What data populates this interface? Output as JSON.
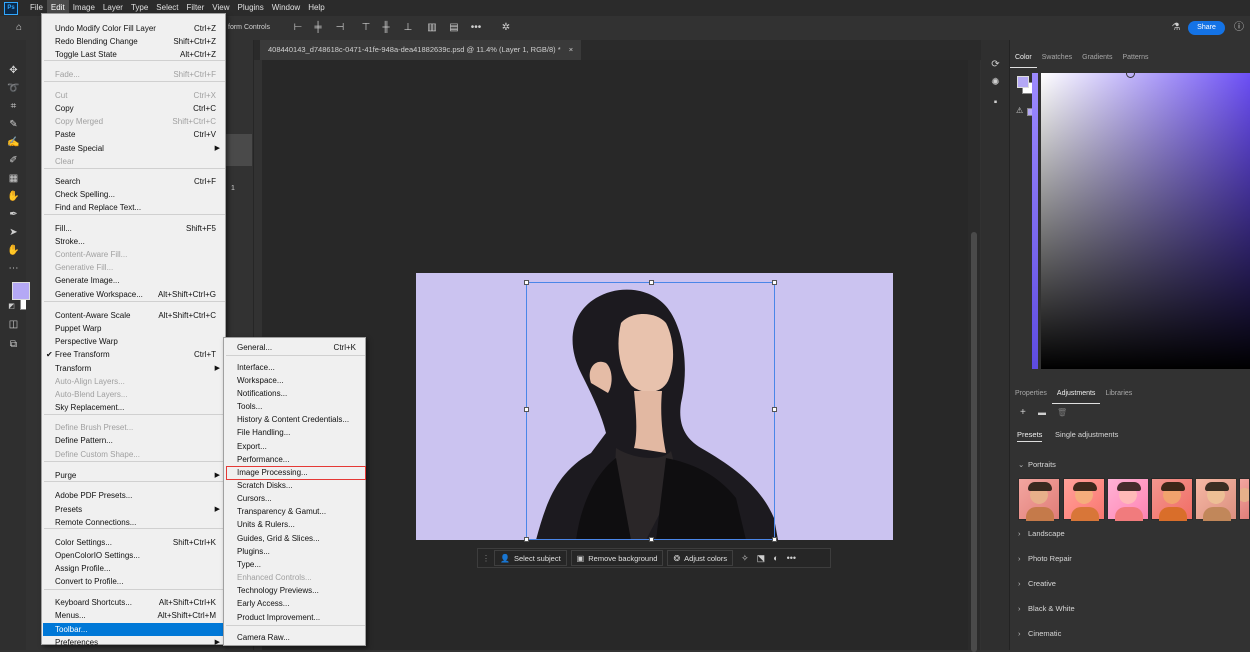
{
  "menubar": {
    "app_logo": "Ps",
    "items": [
      "File",
      "Edit",
      "Image",
      "Layer",
      "Type",
      "Select",
      "Filter",
      "View",
      "Plugins",
      "Window",
      "Help"
    ]
  },
  "options_bar": {
    "transform_controls_label": "form Controls",
    "share_label": "Share",
    "icons": [
      "home-icon",
      "align-icons",
      "more-icon",
      "gear-icon",
      "flask-icon"
    ]
  },
  "document": {
    "tab_title": "408440143_d748618c-0471-41fe-948a-dea41882639c.psd @ 11.4% (Layer 1, RGB/8) *",
    "tab_close": "×"
  },
  "left_panel": {
    "fragment": "1"
  },
  "edit_menu": {
    "items": [
      {
        "label": "Undo Modify Color Fill Layer",
        "shortcut": "Ctrl+Z"
      },
      {
        "label": "Redo Blending Change",
        "shortcut": "Shift+Ctrl+Z"
      },
      {
        "label": "Toggle Last State",
        "shortcut": "Alt+Ctrl+Z"
      },
      {
        "label": "Fade...",
        "shortcut": "Shift+Ctrl+F",
        "disabled": true
      },
      {
        "label": "Cut",
        "shortcut": "Ctrl+X",
        "disabled": true
      },
      {
        "label": "Copy",
        "shortcut": "Ctrl+C"
      },
      {
        "label": "Copy Merged",
        "shortcut": "Shift+Ctrl+C",
        "disabled": true
      },
      {
        "label": "Paste",
        "shortcut": "Ctrl+V"
      },
      {
        "label": "Paste Special",
        "submenu": true
      },
      {
        "label": "Clear",
        "disabled": true
      },
      {
        "label": "Search",
        "shortcut": "Ctrl+F"
      },
      {
        "label": "Check Spelling..."
      },
      {
        "label": "Find and Replace Text..."
      },
      {
        "label": "Fill...",
        "shortcut": "Shift+F5"
      },
      {
        "label": "Stroke..."
      },
      {
        "label": "Content-Aware Fill...",
        "disabled": true
      },
      {
        "label": "Generative Fill...",
        "disabled": true
      },
      {
        "label": "Generate Image..."
      },
      {
        "label": "Generative Workspace...",
        "shortcut": "Alt+Shift+Ctrl+G"
      },
      {
        "label": "Content-Aware Scale",
        "shortcut": "Alt+Shift+Ctrl+C"
      },
      {
        "label": "Puppet Warp"
      },
      {
        "label": "Perspective Warp"
      },
      {
        "label": "Free Transform",
        "shortcut": "Ctrl+T",
        "checked": true
      },
      {
        "label": "Transform",
        "submenu": true
      },
      {
        "label": "Auto-Align Layers...",
        "disabled": true
      },
      {
        "label": "Auto-Blend Layers...",
        "disabled": true
      },
      {
        "label": "Sky Replacement..."
      },
      {
        "label": "Define Brush Preset...",
        "disabled": true
      },
      {
        "label": "Define Pattern..."
      },
      {
        "label": "Define Custom Shape...",
        "disabled": true
      },
      {
        "label": "Purge",
        "submenu": true
      },
      {
        "label": "Adobe PDF Presets..."
      },
      {
        "label": "Presets",
        "submenu": true
      },
      {
        "label": "Remote Connections..."
      },
      {
        "label": "Color Settings...",
        "shortcut": "Shift+Ctrl+K"
      },
      {
        "label": "OpenColorIO Settings..."
      },
      {
        "label": "Assign Profile..."
      },
      {
        "label": "Convert to Profile..."
      },
      {
        "label": "Keyboard Shortcuts...",
        "shortcut": "Alt+Shift+Ctrl+K"
      },
      {
        "label": "Menus...",
        "shortcut": "Alt+Shift+Ctrl+M"
      },
      {
        "label": "Toolbar...",
        "highlighted": true
      },
      {
        "label": "Preferences",
        "submenu": true
      }
    ]
  },
  "preferences_submenu": {
    "items": [
      {
        "label": "General...",
        "shortcut": "Ctrl+K"
      },
      {
        "label": "Interface..."
      },
      {
        "label": "Workspace..."
      },
      {
        "label": "Notifications..."
      },
      {
        "label": "Tools..."
      },
      {
        "label": "History & Content Credentials..."
      },
      {
        "label": "File Handling..."
      },
      {
        "label": "Export..."
      },
      {
        "label": "Performance..."
      },
      {
        "label": "Image Processing...",
        "boxed": true
      },
      {
        "label": "Scratch Disks..."
      },
      {
        "label": "Cursors..."
      },
      {
        "label": "Transparency & Gamut..."
      },
      {
        "label": "Units & Rulers..."
      },
      {
        "label": "Guides, Grid & Slices..."
      },
      {
        "label": "Plugins..."
      },
      {
        "label": "Type..."
      },
      {
        "label": "Enhanced Controls...",
        "disabled": true
      },
      {
        "label": "Technology Previews..."
      },
      {
        "label": "Early Access..."
      },
      {
        "label": "Product Improvement..."
      },
      {
        "label": "Camera Raw..."
      }
    ]
  },
  "context_bar": {
    "select_subject": "Select subject",
    "remove_background": "Remove background",
    "adjust_colors": "Adjust colors",
    "more": "•••"
  },
  "color_panel": {
    "tabs": [
      "Color",
      "Swatches",
      "Gradients",
      "Patterns"
    ],
    "active_tab": "Color",
    "foreground": "#b4a8f5",
    "background": "#ffffff",
    "hue_color": "#6c4ff6"
  },
  "adjustments_panel": {
    "tabs": [
      "Properties",
      "Adjustments",
      "Libraries"
    ],
    "active_tab": "Adjustments",
    "subtabs": [
      "Presets",
      "Single adjustments"
    ],
    "active_subtab": "Presets",
    "groups": [
      "Portraits",
      "Landscape",
      "Photo Repair",
      "Creative",
      "Black & White",
      "Cinematic"
    ],
    "portrait_thumbnail_count": 5
  }
}
